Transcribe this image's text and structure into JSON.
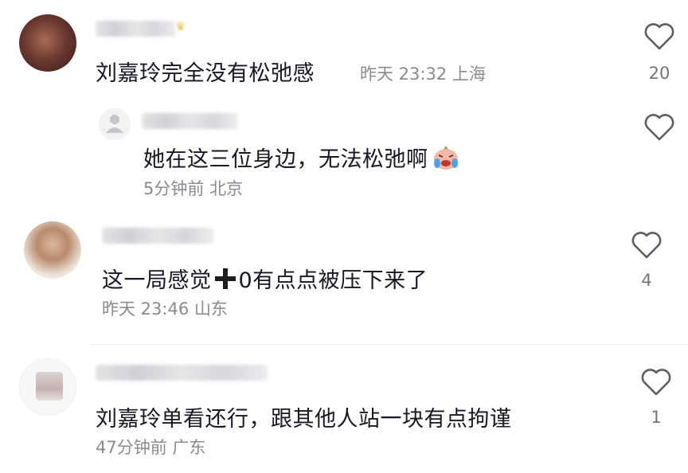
{
  "comments": [
    {
      "text": "刘嘉玲完全没有松弛感",
      "time": "昨天 23:32",
      "location": "上海",
      "likes": "20",
      "avatar_icon": "user-photo-avatar",
      "badge_icon": "crown-icon"
    },
    {
      "text": "她在这三位身边，无法松弛啊",
      "emoji": "crying-laughing-emoji",
      "time": "5分钟前",
      "location": "北京",
      "likes": "",
      "avatar_icon": "default-user-icon"
    },
    {
      "text_before": "这一局感觉",
      "plus_icon": "plus-icon",
      "text_after": "0有点点被压下来了",
      "time": "昨天 23:46",
      "location": "山东",
      "likes": "4",
      "avatar_icon": "user-photo-avatar"
    },
    {
      "text": "刘嘉玲单看还行，跟其他人站一块有点拘谨",
      "time": "47分钟前",
      "location": "广东",
      "likes": "1",
      "avatar_icon": "user-photo-avatar"
    }
  ],
  "colors": {
    "text": "#161823",
    "meta": "#8a8b91",
    "like_outline": "#5c5d63"
  },
  "icons": {
    "like": "heart-outline-icon"
  }
}
